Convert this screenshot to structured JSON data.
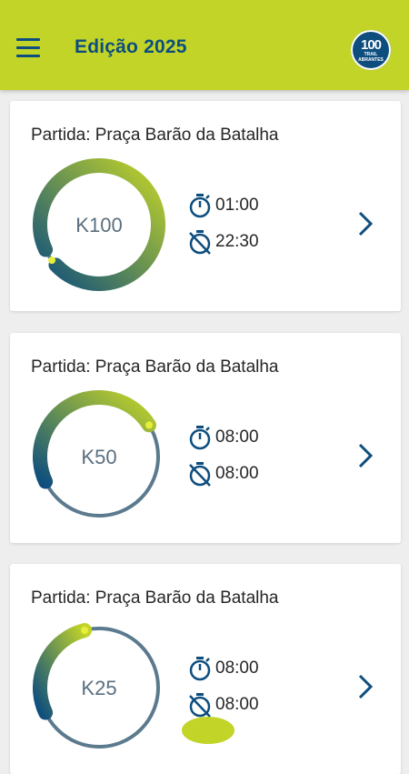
{
  "app": {
    "title": "Edição 2025",
    "menu_icon": "hamburger-menu-icon"
  },
  "logo": {
    "number": "100",
    "line1": "TRAIL",
    "line2": "ABRANTES"
  },
  "colors": {
    "accent": "#c2d428",
    "primary": "#0d4e7e",
    "track": "#5c7a8e",
    "text": "#262626",
    "distance_text": "#5a6f7f"
  },
  "races": [
    {
      "start": "Partida: Praça Barão da Batalha",
      "distance": "K100",
      "start_time": "01:00",
      "cutoff_time": "22:30",
      "progress": 0.95
    },
    {
      "start": "Partida: Praça Barão da Batalha",
      "distance": "K50",
      "start_time": "08:00",
      "cutoff_time": "08:00",
      "progress": 0.48
    },
    {
      "start": "Partida: Praça Barão da Batalha",
      "distance": "K25",
      "start_time": "08:00",
      "cutoff_time": "08:00",
      "progress": 0.28
    }
  ]
}
